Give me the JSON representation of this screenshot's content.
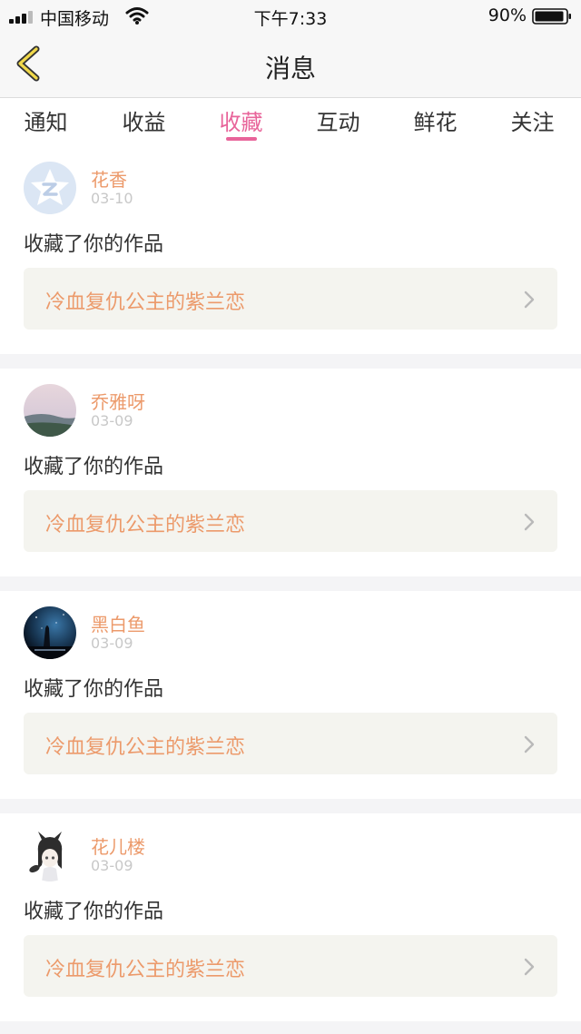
{
  "status_bar": {
    "carrier": "中国移动",
    "time": "下午7:33",
    "battery": "90%",
    "icons": [
      "signal-icon",
      "wifi-icon",
      "battery-icon"
    ]
  },
  "header": {
    "title": "消息",
    "back_icon": "chevron-left-icon"
  },
  "tabs": [
    {
      "label": "通知"
    },
    {
      "label": "收益"
    },
    {
      "label": "收藏",
      "active": true
    },
    {
      "label": "互动"
    },
    {
      "label": "鲜花"
    },
    {
      "label": "关注"
    }
  ],
  "messages": [
    {
      "user": "花香",
      "date": "03-10",
      "action": "收藏了你的作品",
      "work": "冷血复仇公主的紫兰恋",
      "avatar": "qq-star-avatar"
    },
    {
      "user": "乔雅呀",
      "date": "03-09",
      "action": "收藏了你的作品",
      "work": "冷血复仇公主的紫兰恋",
      "avatar": "landscape-avatar"
    },
    {
      "user": "黑白鱼",
      "date": "03-09",
      "action": "收藏了你的作品",
      "work": "冷血复仇公主的紫兰恋",
      "avatar": "night-sky-avatar"
    },
    {
      "user": "花儿楼",
      "date": "03-09",
      "action": "收藏了你的作品",
      "work": "冷血复仇公主的紫兰恋",
      "avatar": "anime-girl-avatar"
    }
  ],
  "colors": {
    "accent": "#e8649a",
    "username": "#ec9a6b",
    "work_box": "#f4f4ef"
  }
}
